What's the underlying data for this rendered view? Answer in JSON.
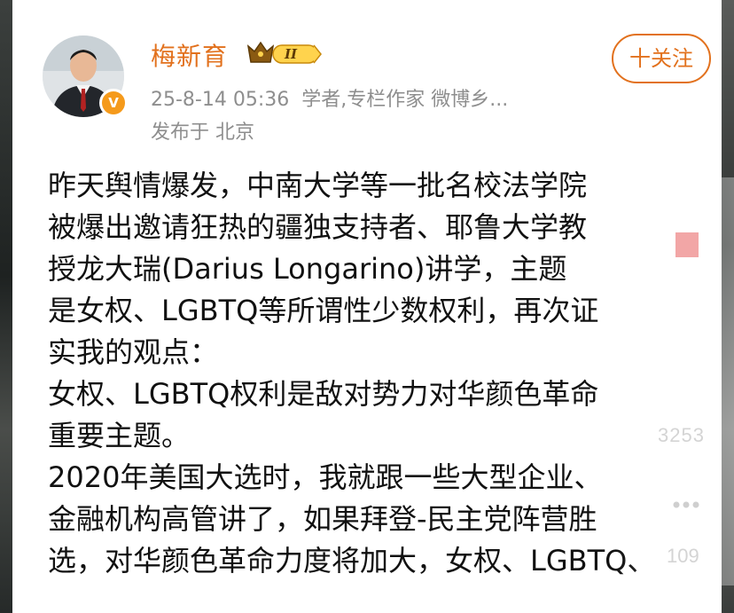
{
  "author": {
    "name": "梅新育",
    "badge_level": "II",
    "verified_badge": "V",
    "avatar_icon": "avatar-man-in-suit"
  },
  "meta": {
    "timestamp": "25-8-14 05:36",
    "title": "学者,专栏作家 微博乡...",
    "location": "发布于 北京"
  },
  "follow_button": {
    "label": "十关注"
  },
  "post": {
    "lines": [
      "昨天舆情爆发，中南大学等一批名校法学院",
      "被爆出邀请狂热的疆独支持者、耶鲁大学教",
      "授龙大瑞(Darius Longarino)讲学，主题",
      "是女权、LGBTQ等所谓性少数权利，再次证",
      "实我的观点：",
      "女权、LGBTQ权利是敌对势力对华颜色革命",
      "重要主题。",
      "2020年美国大选时，我就跟一些大型企业、",
      "金融机构高管讲了，如果拜登-民主党阵营胜",
      "选，对华颜色革命力度将加大，女权、LGBTQ、"
    ]
  },
  "side_actions": {
    "like_count": "3253",
    "comment_count": "109"
  },
  "colors": {
    "accent": "#e2711d",
    "meta_gray": "#8e8e8e",
    "text": "#111111"
  }
}
